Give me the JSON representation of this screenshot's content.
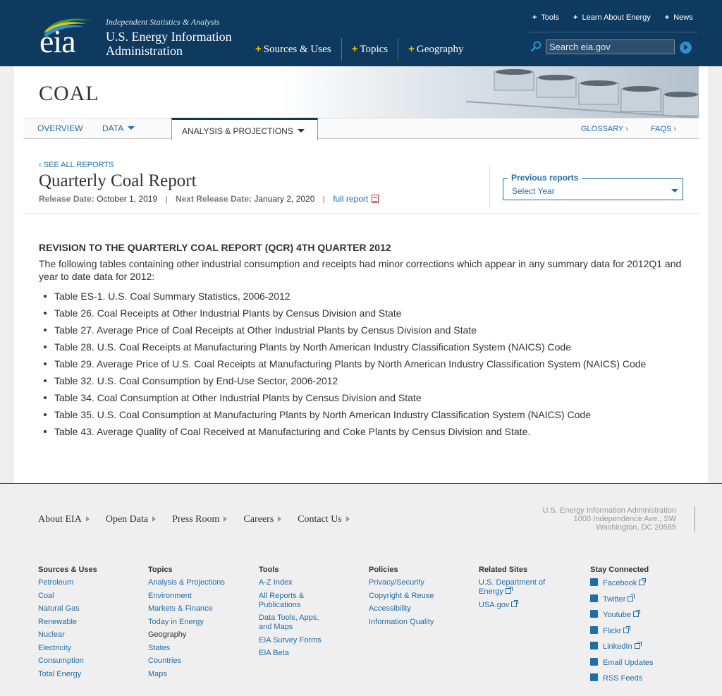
{
  "header": {
    "logo_text": "eia",
    "tagline": "Independent Statistics & Analysis",
    "agency_line1": "U.S. Energy Information",
    "agency_line2": "Administration",
    "main_nav": [
      "Sources & Uses",
      "Topics",
      "Geography"
    ],
    "util_nav": [
      "Tools",
      "Learn About Energy",
      "News"
    ],
    "search_placeholder": "Search eia.gov"
  },
  "section": {
    "title": "COAL",
    "subnav": {
      "overview": "OVERVIEW",
      "data": "DATA",
      "analysis": "ANALYSIS & PROJECTIONS",
      "glossary": "GLOSSARY ›",
      "faqs": "FAQS ›"
    }
  },
  "report": {
    "see_all": "‹ SEE ALL REPORTS",
    "title": "Quarterly Coal Report",
    "release_label": "Release Date:",
    "release_date": "October 1, 2019",
    "next_label": "Next Release Date:",
    "next_date": "January 2, 2020",
    "full_report": "full report",
    "previous_label": "Previous reports",
    "previous_value": "Select Year"
  },
  "revision": {
    "heading": "REVISION TO THE QUARTERLY COAL REPORT (QCR) 4TH QUARTER 2012",
    "intro": "The following tables containing other industrial consumption and receipts had minor corrections which appear in any summary data for 2012Q1 and year to date data for 2012:",
    "tables": [
      "Table ES-1. U.S. Coal Summary Statistics, 2006-2012",
      "Table 26. Coal Receipts at Other Industrial Plants by Census Division and State",
      "Table 27. Average Price of Coal Receipts at Other Industrial Plants by Census Division and State",
      "Table 28. U.S. Coal Receipts at Manufacturing Plants by North American Industry Classification System (NAICS) Code",
      "Table 29. Average Price of U.S. Coal Receipts at Manufacturing Plants by North American Industry Classification System (NAICS) Code",
      "Table 32. U.S. Coal Consumption by End-Use Sector, 2006-2012",
      "Table 34. Coal Consumption at Other Industrial Plants by Census Division and State",
      "Table 35. U.S. Coal Consumption at Manufacturing Plants by North American Industry Classification System (NAICS) Code",
      "Table 43. Average Quality of Coal Received at Manufacturing and Coke Plants by Census Division and State."
    ]
  },
  "footer": {
    "nav": [
      "About EIA",
      "Open Data",
      "Press Room",
      "Careers",
      "Contact Us"
    ],
    "address": [
      "U.S. Energy Information Administration",
      "1000 Independence Ave., SW",
      "Washington, DC 20585"
    ],
    "columns": {
      "sources": {
        "title": "Sources & Uses",
        "links": [
          "Petroleum",
          "Coal",
          "Natural Gas",
          "Renewable",
          "Nuclear",
          "Electricity",
          "Consumption",
          "Total Energy"
        ]
      },
      "topics": {
        "title": "Topics",
        "links": [
          "Analysis & Projections",
          "Environment",
          "Markets & Finance",
          "Today in Energy"
        ],
        "sub_title": "Geography",
        "sub_links": [
          "States",
          "Countries",
          "Maps"
        ]
      },
      "tools": {
        "title": "Tools",
        "links": [
          "A-Z Index",
          "All Reports & Publications",
          "Data Tools, Apps, and Maps",
          "EIA Survey Forms",
          "EIA Beta"
        ]
      },
      "policies": {
        "title": "Policies",
        "links": [
          "Privacy/Security",
          "Copyright & Reuse",
          "Accessibility",
          "Information Quality"
        ]
      },
      "related": {
        "title": "Related Sites",
        "links": [
          "U.S. Department of Energy",
          "USA.gov"
        ]
      },
      "social": {
        "title": "Stay Connected",
        "links": [
          "Facebook",
          "Twitter",
          "Youtube",
          "Flickr",
          "LinkedIn",
          "Email Updates",
          "RSS Feeds"
        ]
      }
    }
  },
  "colors": {
    "header_bg": "#0d3a5e",
    "link": "#1f6ea7",
    "nav_plus": "#f5c300"
  }
}
